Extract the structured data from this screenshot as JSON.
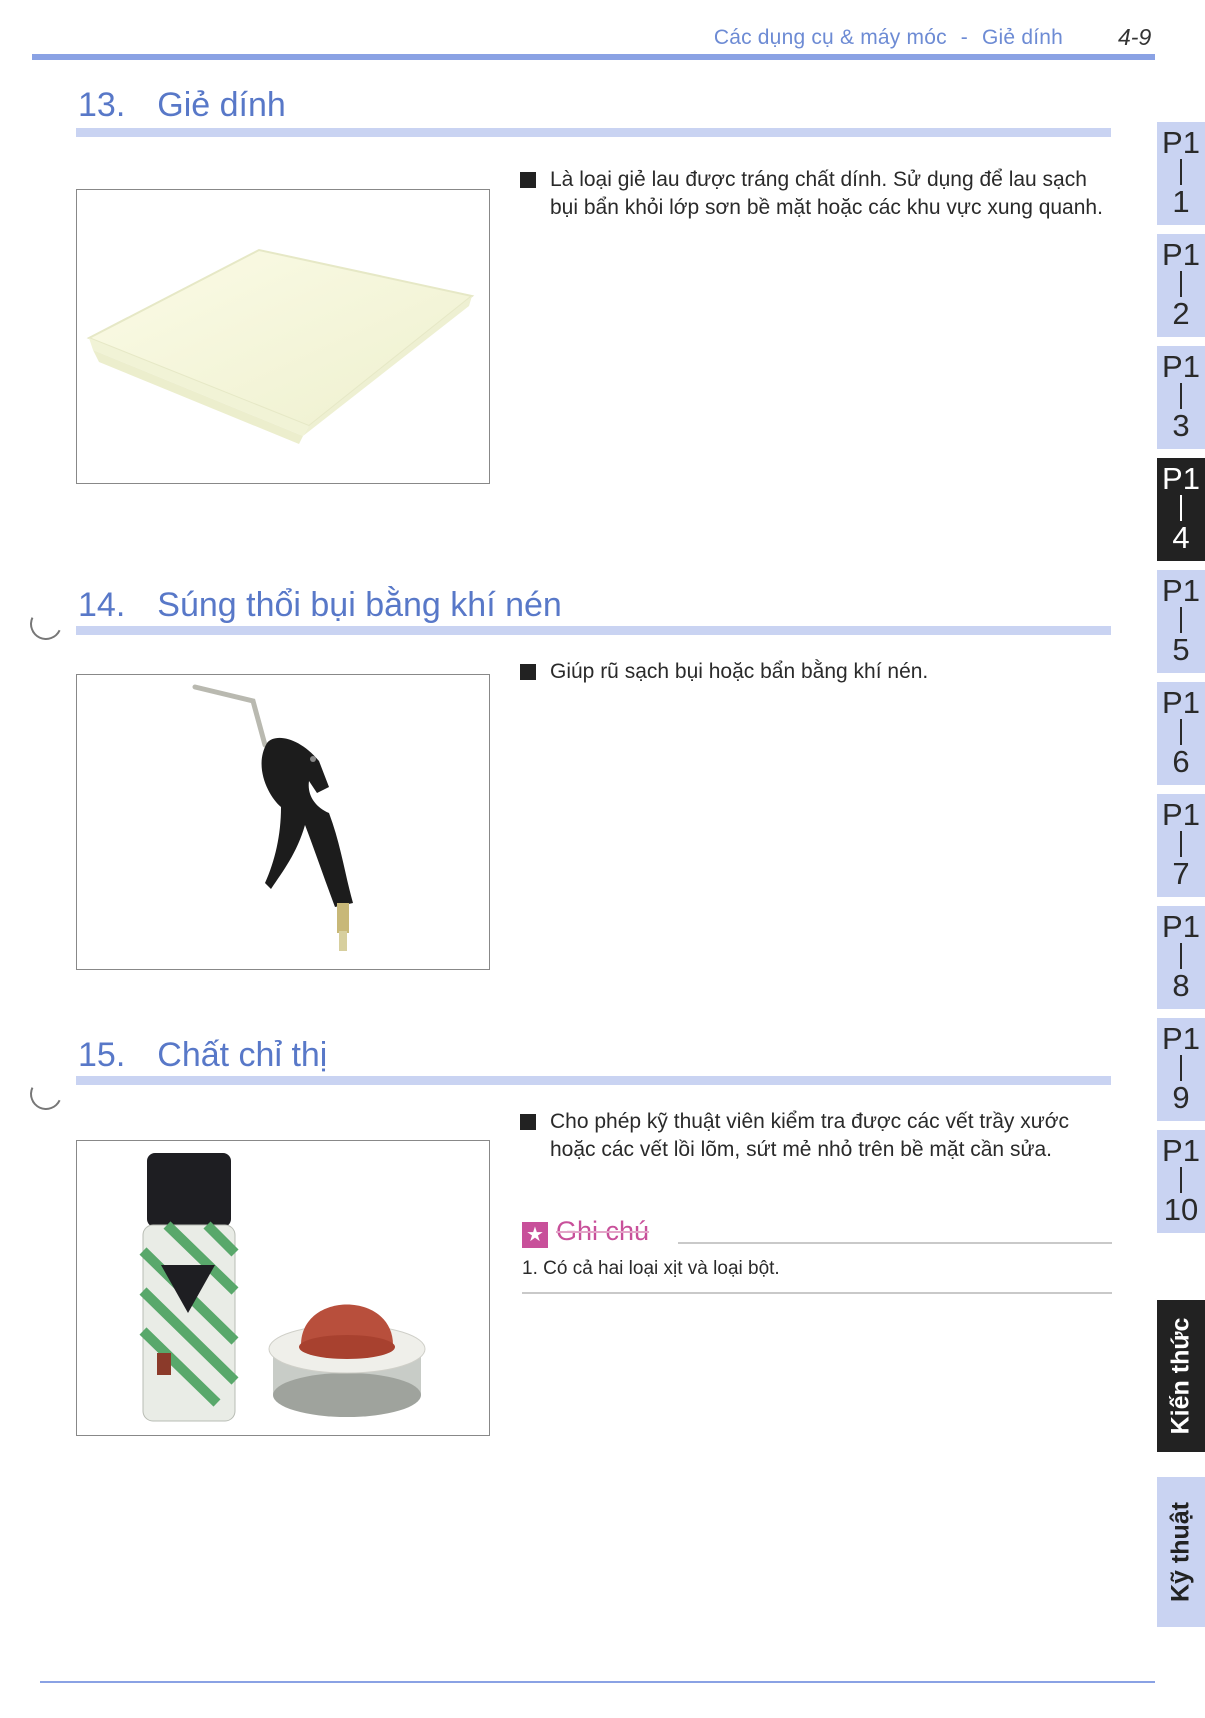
{
  "header": {
    "chapter": "Các dụng cụ & máy móc",
    "separator": "-",
    "topic": "Giẻ dính",
    "page": "4-9"
  },
  "sections": [
    {
      "number": "13.",
      "title": "Giẻ dính",
      "description": "Là loại giẻ lau được tráng chất dính. Sử dụng để lau sạch bụi bẩn khỏi lớp sơn bề mặt hoặc các khu vực xung quanh."
    },
    {
      "number": "14.",
      "title": "Súng thổi bụi bằng khí nén",
      "description": "Giúp rũ sạch bụi hoặc bẩn bằng khí nén."
    },
    {
      "number": "15.",
      "title": "Chất chỉ thị",
      "description": "Cho phép kỹ thuật viên kiểm tra được các vết trầy xước hoặc các vết lồi lõm, sứt mẻ nhỏ trên bề mặt cần sửa.",
      "note": {
        "label": "Ghi chú",
        "items": [
          "1.  Có cả hai loại xịt và loại bột."
        ]
      }
    }
  ],
  "side_tabs": [
    {
      "prefix": "P1",
      "num": "1"
    },
    {
      "prefix": "P1",
      "num": "2"
    },
    {
      "prefix": "P1",
      "num": "3"
    },
    {
      "prefix": "P1",
      "num": "4"
    },
    {
      "prefix": "P1",
      "num": "5"
    },
    {
      "prefix": "P1",
      "num": "6"
    },
    {
      "prefix": "P1",
      "num": "7"
    },
    {
      "prefix": "P1",
      "num": "8"
    },
    {
      "prefix": "P1",
      "num": "9"
    },
    {
      "prefix": "P1",
      "num": "10"
    }
  ],
  "active_tab": "4",
  "vertical_tabs": {
    "knowledge": "Kiến thức",
    "technique": "Kỹ thuật"
  },
  "colors": {
    "accent_blue": "#6d8bd4",
    "title_rule": "#c9d3f2",
    "note_pink": "#c8509a",
    "dark_tab": "#222222"
  }
}
